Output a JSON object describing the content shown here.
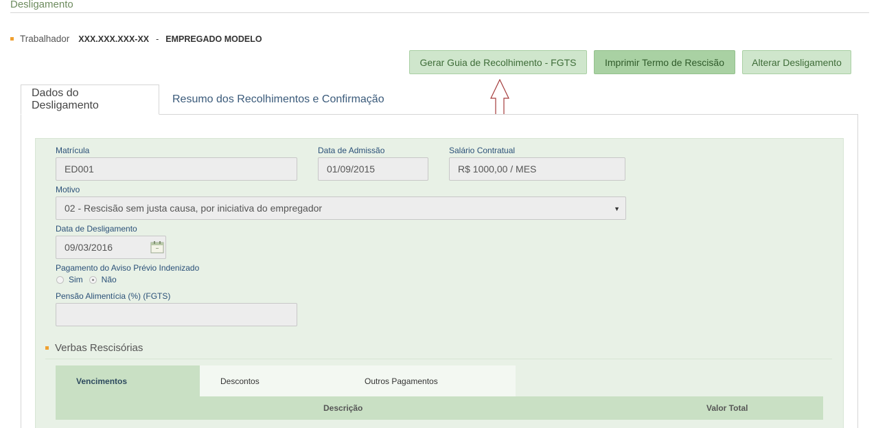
{
  "page": {
    "title": "Desligamento"
  },
  "worker": {
    "label": "Trabalhador",
    "id": "XXX.XXX.XXX-XX",
    "separator": "-",
    "name": "EMPREGADO MODELO"
  },
  "actions": {
    "generate_fgts": "Gerar Guia de Recolhimento - FGTS",
    "print_termination": "Imprimir Termo de Rescisão",
    "alter_termination": "Alterar Desligamento"
  },
  "tabs": [
    {
      "label": "Dados do Desligamento",
      "active": true
    },
    {
      "label": "Resumo dos Recolhimentos e Confirmação",
      "active": false
    }
  ],
  "form": {
    "registration": {
      "label": "Matrícula",
      "value": "ED001"
    },
    "admission_date": {
      "label": "Data de Admissão",
      "value": "01/09/2015"
    },
    "salary": {
      "label": "Salário Contratual",
      "value": "R$ 1000,00 / MES"
    },
    "reason": {
      "label": "Motivo",
      "value": "02 - Rescisão sem justa causa, por iniciativa do empregador"
    },
    "termination_date": {
      "label": "Data de Desligamento",
      "value": "09/03/2016"
    },
    "notice_payment": {
      "label": "Pagamento do Aviso Prévio Indenizado",
      "options": [
        "Sim",
        "Não"
      ],
      "selected": "Não"
    },
    "alimony": {
      "label": "Pensão Alimentícia (%) (FGTS)",
      "value": ""
    }
  },
  "severance": {
    "title": "Verbas Rescisórias",
    "tabs": [
      "Vencimentos",
      "Descontos",
      "Outros Pagamentos"
    ],
    "active_tab": "Vencimentos",
    "columns": [
      "Descrição",
      "Valor Total"
    ]
  },
  "colors": {
    "accent_green": "#cfe6cc",
    "active_green": "#a9d1a3",
    "bullet_orange": "#f0a030",
    "arrow_red": "#a33a3a"
  },
  "icons": {
    "calendar": "calendar-icon",
    "arrow": "up-arrow-icon",
    "dropdown": "chevron-down-icon"
  }
}
